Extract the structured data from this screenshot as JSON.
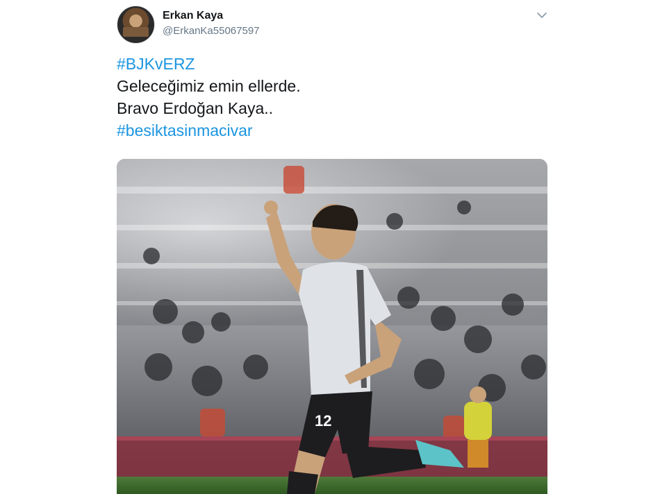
{
  "user": {
    "display_name": "Erkan Kaya",
    "handle": "@ErkanKa55067597",
    "avatar_icon": "profile-photo"
  },
  "menu": {
    "icon": "chevron-down-icon"
  },
  "tweet": {
    "lines": [
      {
        "text": "#BJKvERZ",
        "type": "hashtag"
      },
      {
        "text": "Geleceğimiz emin ellerde.",
        "type": "text"
      },
      {
        "text": "Bravo Erdoğan Kaya..",
        "type": "text"
      },
      {
        "text": "#besiktasinmacivar",
        "type": "hashtag"
      }
    ]
  },
  "media": {
    "shirt_number": "12",
    "colors": {
      "hashtag": "#1b95e0",
      "name": "#14171a",
      "handle": "#657786"
    }
  }
}
